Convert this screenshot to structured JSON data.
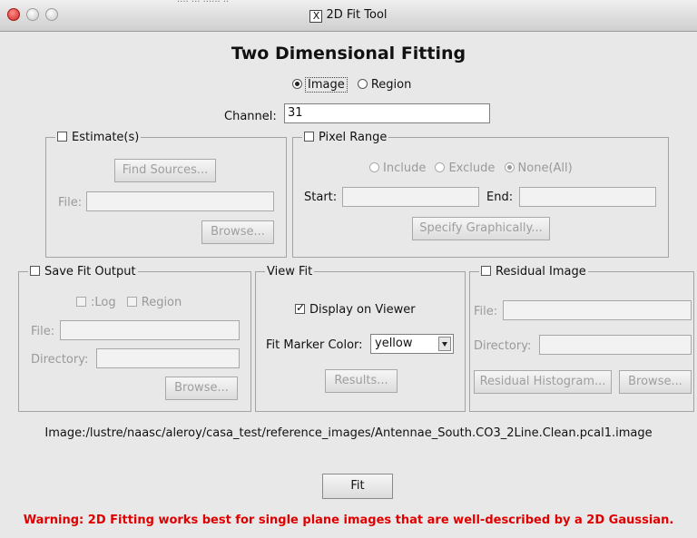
{
  "window": {
    "title": "2D Fit Tool",
    "ghost_title": "···· ··· ······ ··"
  },
  "heading": "Two Dimensional Fitting",
  "mode": {
    "image_label": "Image",
    "region_label": "Region",
    "selected": "Image"
  },
  "channel": {
    "label": "Channel:",
    "value": "31"
  },
  "estimates": {
    "title": "Estimate(s)",
    "find_sources": "Find Sources...",
    "file_label": "File:",
    "browse": "Browse..."
  },
  "pixel_range": {
    "title": "Pixel Range",
    "include": "Include",
    "exclude": "Exclude",
    "none_all": "None(All)",
    "start_label": "Start:",
    "end_label": "End:",
    "specify": "Specify Graphically..."
  },
  "save_fit": {
    "title": "Save Fit Output",
    "log": ":Log",
    "region": "Region",
    "file_label": "File:",
    "directory_label": "Directory:",
    "browse": "Browse..."
  },
  "view_fit": {
    "title": "View Fit",
    "display_on_viewer": "Display on Viewer",
    "display_checked": true,
    "marker_label": "Fit Marker Color:",
    "marker_color": "yellow",
    "results": "Results..."
  },
  "residual": {
    "title": "Residual Image",
    "file_label": "File:",
    "directory_label": "Directory:",
    "histogram": "Residual Histogram...",
    "browse": "Browse..."
  },
  "image_path": "Image:/lustre/naasc/aleroy/casa_test/reference_images/Antennae_South.CO3_2Line.Clean.pcal1.image",
  "fit_button": "Fit",
  "warning": "Warning: 2D Fitting works best for single plane images that are well-described by a 2D Gaussian.",
  "colors": {
    "warning": "#e00000",
    "background": "#e8e8e8"
  }
}
